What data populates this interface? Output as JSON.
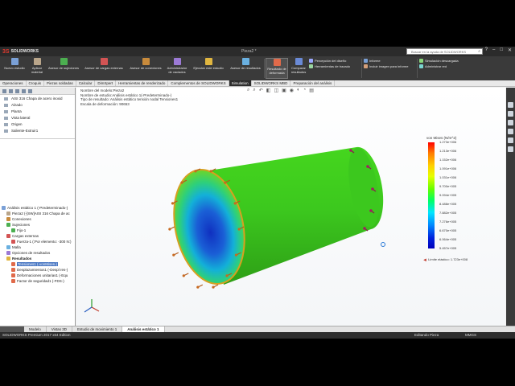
{
  "titlebar": {
    "brand": "SOLIDWORKS",
    "doc_title": "Pieza2 *",
    "search_placeholder": "Buscar en la ayuda de SOLIDWORKS",
    "window_buttons": [
      "?",
      "–",
      "□",
      "✕"
    ]
  },
  "ribbon": {
    "buttons": [
      {
        "label": "Nuevo estudio",
        "color": "#7aa0d6"
      },
      {
        "label": "Aplicar material",
        "color": "#b9a58a"
      },
      {
        "label": "Asesor de sujeciones",
        "color": "#4caf50"
      },
      {
        "label": "Asesor de cargas externas",
        "color": "#d35454"
      },
      {
        "label": "Asesor de conexiones",
        "color": "#c98b3c"
      },
      {
        "label": "Administrador de vaciados",
        "color": "#9c7ad6"
      },
      {
        "label": "Ejecutar este estudio",
        "color": "#e0b640"
      },
      {
        "label": "Asesor de resultados",
        "color": "#6ab0e0"
      },
      {
        "label": "Resultado de deformada",
        "color": "#e06a4a"
      },
      {
        "label": "Comparar resultados",
        "color": "#6a8ad6"
      }
    ],
    "small": [
      "Percepción del diseño",
      "Herramientas de trazado",
      "Informe",
      "Incluir imagen para informe",
      "Simulación descargada",
      "Administrar red"
    ]
  },
  "tabs": [
    "Operaciones",
    "Croquis",
    "Piezas soldadas",
    "Calcular",
    "DimXpert",
    "Herramientas de renderizado",
    "Complementos de SOLIDWORKS",
    "Simulation",
    "SOLIDWORKS MBD",
    "Preparación del análisis"
  ],
  "active_tab": "Simulation",
  "materials": [
    "AISI 316 Chapa de acero inoxid",
    "Alzado",
    "Planta",
    "Vista lateral",
    "Origen",
    "Saliente-Extruir1"
  ],
  "tree": [
    {
      "label": "Análisis estático 1 (-Predeterminado-)",
      "indent": 0,
      "color": "#7aa0d6"
    },
    {
      "label": "Pieza2 (-[SW]AISI 316 Chapa de ac",
      "indent": 2,
      "color": "#b9a58a"
    },
    {
      "label": "Conexiones",
      "indent": 2,
      "color": "#c98b3c"
    },
    {
      "label": "Sujeciones",
      "indent": 2,
      "color": "#4caf50"
    },
    {
      "label": "Fijo-1",
      "indent": 4,
      "color": "#4caf50"
    },
    {
      "label": "Cargas externas",
      "indent": 2,
      "color": "#d35454"
    },
    {
      "label": "Fuerza-1 (:Por elemento: -300 N:)",
      "indent": 4,
      "color": "#d35454"
    },
    {
      "label": "Malla",
      "indent": 2,
      "color": "#6ab0e0"
    },
    {
      "label": "Opciones de resultados",
      "indent": 2,
      "color": "#9c7ad6"
    },
    {
      "label": "Resultados",
      "indent": 2,
      "color": "#e0b640",
      "bold": true
    },
    {
      "label": "Tensiones1 (-vonMises-)",
      "indent": 4,
      "color": "#e06a4a",
      "selected": true
    },
    {
      "label": "Desplazamientos1 (-Despl res-)",
      "indent": 4,
      "color": "#e06a4a"
    },
    {
      "label": "Deformaciones unitarias1 (-Equ",
      "indent": 4,
      "color": "#e06a4a"
    },
    {
      "label": "Factor de seguridad1 (-FDS-)",
      "indent": 4,
      "color": "#e06a4a"
    }
  ],
  "viewport": {
    "info": [
      "Nombre del modelo:Pieza2",
      "Nombre de estudio:Análisis estático 1(-Predeterminado-)",
      "Tipo de resultado: Análisis estático tensión nodal Tensiones1",
      "Escala de deformación: 90653"
    ],
    "headsup_icons": [
      "zoom-fit-icon",
      "zoom-area-icon",
      "previous-view-icon",
      "section-view-icon",
      "view-orientation-icon",
      "display-style-icon",
      "hide-show-icon",
      "edit-appearance-icon",
      "apply-scene-icon",
      "view-settings-icon"
    ]
  },
  "legend": {
    "title": "von Mises (N/m^2)",
    "values": [
      "1.273e+006",
      "1.213e+006",
      "1.152e+006",
      "1.091e+006",
      "1.031e+006",
      "9.700e+005",
      "9.094e+005",
      "8.488e+005",
      "7.882e+005",
      "7.276e+005",
      "6.670e+005",
      "6.064e+005",
      "5.457e+005"
    ],
    "yield_label": "Límite elástico: 1.723e+008"
  },
  "bottom_tabs": [
    "Modelo",
    "Vistas 3D",
    "Estudio de movimiento 1",
    "Análisis estático 1"
  ],
  "active_bottom_tab": "Análisis estático 1",
  "status": {
    "app": "SOLIDWORKS Premium 2017 x64 Edition",
    "mode": "Editando Pieza",
    "units": "MMGS"
  },
  "colors": {
    "cylinder_body": "#3cc81e",
    "end_cap_center": "#1a3fbf"
  }
}
